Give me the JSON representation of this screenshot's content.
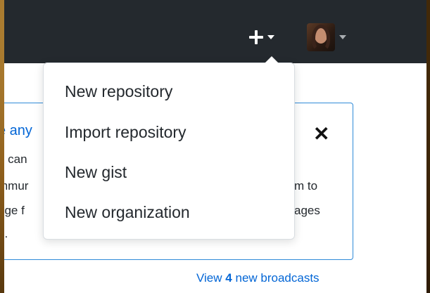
{
  "header": {
    "create_icon": "plus-icon",
    "avatar_icon": "user-avatar"
  },
  "create_menu": {
    "items": [
      {
        "label": "New repository"
      },
      {
        "label": "Import repository"
      },
      {
        "label": "New gist"
      },
      {
        "label": "New organization"
      }
    ]
  },
  "broadcast_card": {
    "title_fragment": "e any",
    "line1_fragment": "u can",
    "line2_left": "mmur",
    "line2_right": "m to",
    "line3_left": "nge f",
    "line3_right": "ages",
    "line4_left": "e.",
    "close_label": "✕"
  },
  "broadcasts_link": {
    "prefix": "View",
    "count": "4",
    "suffix": "new broadcasts"
  },
  "colors": {
    "header_bg": "#24292e",
    "link": "#0366d6",
    "card_border": "#2f8ad8"
  }
}
